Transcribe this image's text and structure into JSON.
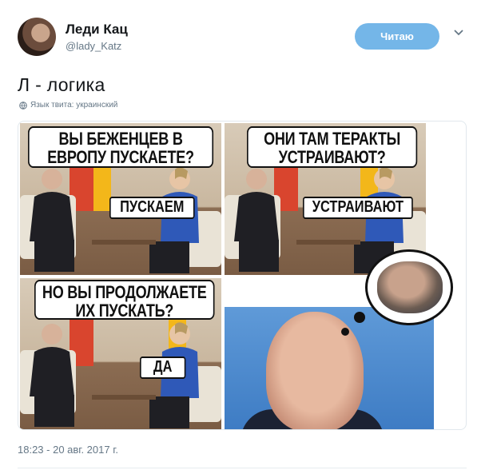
{
  "user": {
    "name": "Леди Кац",
    "handle": "@lady_Katz"
  },
  "follow_button": "Читаю",
  "tweet": {
    "text": "Л - логика",
    "language_note": "Язык твита: украинский",
    "timestamp": "18:23 - 20 авг. 2017 г."
  },
  "meme": {
    "panel1": {
      "question": "ВЫ БЕЖЕНЦЕВ В ЕВРОПУ ПУСКАЕТЕ?",
      "answer": "ПУСКАЕМ"
    },
    "panel2": {
      "question": "ОНИ ТАМ ТЕРАКТЫ УСТРАИВАЮТ?",
      "answer": "УСТРАИВАЮТ"
    },
    "panel3": {
      "question": "НО ВЫ ПРОДОЛЖАЕТЕ ИХ ПУСКАТЬ?",
      "answer": "ДА"
    }
  },
  "colors": {
    "follow_button_bg": "#74b6e8",
    "muted_text": "#657786"
  },
  "icons": {
    "globe": "globe-icon",
    "caret": "chevron-down-icon"
  }
}
